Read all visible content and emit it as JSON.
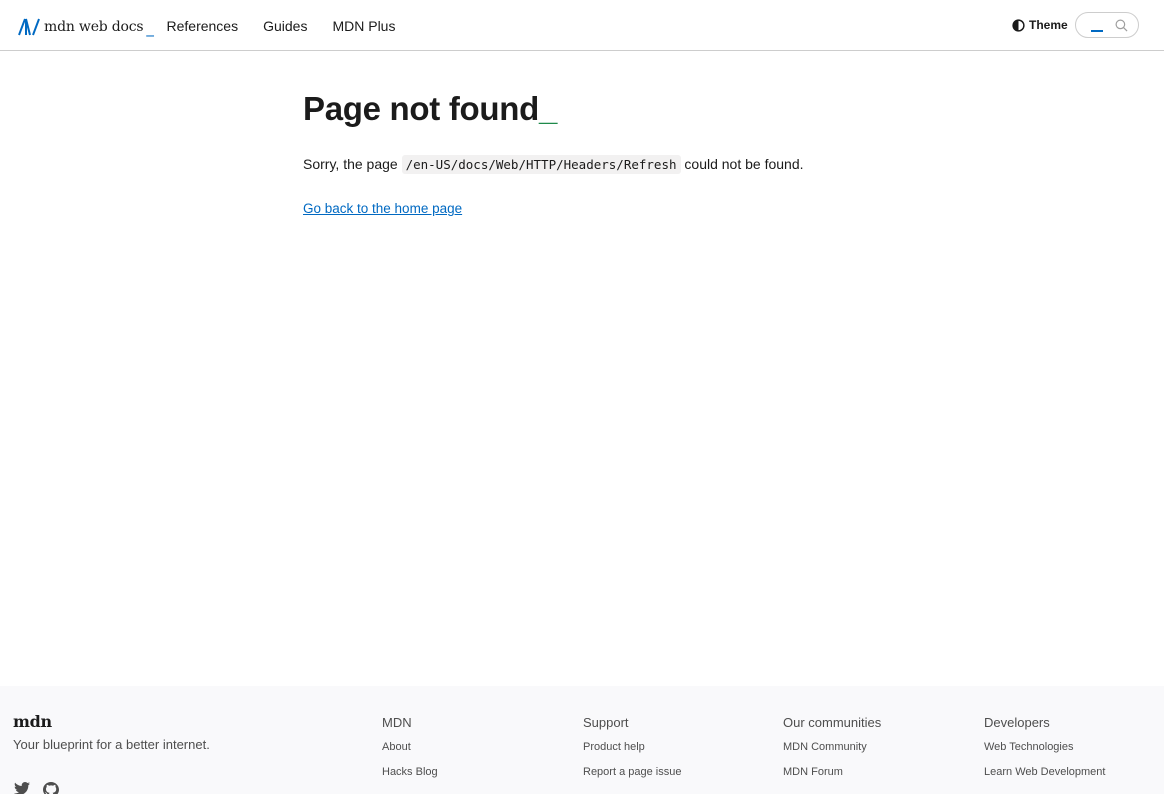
{
  "header": {
    "logo_text": "mdn web docs",
    "logo_underscore": "_",
    "nav": [
      "References",
      "Guides",
      "MDN Plus"
    ],
    "theme_label": "Theme",
    "theme_icon": "contrast-icon",
    "search_icon": "search-icon"
  },
  "main": {
    "title": "Page not found",
    "title_underscore": "_",
    "message_before": "Sorry, the page ",
    "path": "/en-US/docs/Web/HTTP/Headers/Refresh",
    "message_after": " could not be found.",
    "home_link": "Go back to the home page"
  },
  "footer": {
    "logo": "mdn",
    "tagline": "Your blueprint for a better internet.",
    "social": [
      "twitter-icon",
      "github-icon"
    ],
    "columns": [
      {
        "heading": "MDN",
        "links": [
          "About",
          "Hacks Blog"
        ]
      },
      {
        "heading": "Support",
        "links": [
          "Product help",
          "Report a page issue"
        ]
      },
      {
        "heading": "Our communities",
        "links": [
          "MDN Community",
          "MDN Forum"
        ]
      },
      {
        "heading": "Developers",
        "links": [
          "Web Technologies",
          "Learn Web Development"
        ]
      }
    ]
  },
  "colors": {
    "accent_blue": "#0069c2",
    "title_underscore_green": "#1e8a4a",
    "footer_bg": "#f9f9fb"
  }
}
